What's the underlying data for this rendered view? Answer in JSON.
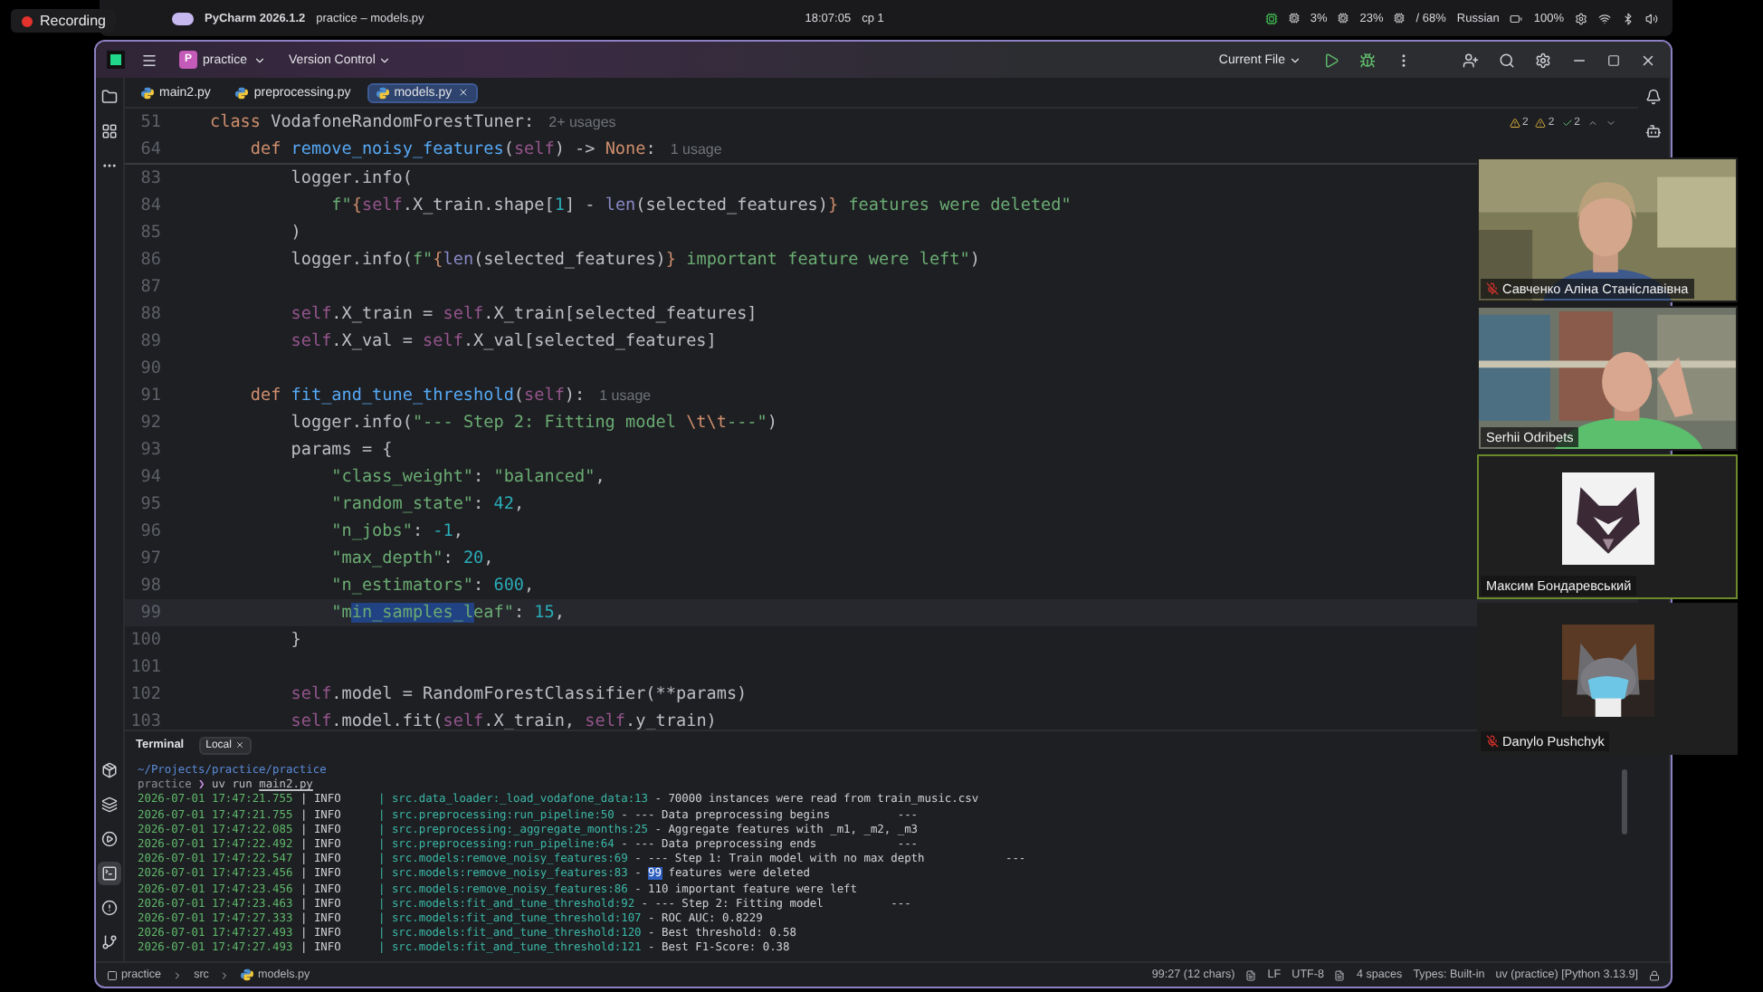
{
  "recording": {
    "label": "Recording"
  },
  "os_bar": {
    "app": "PyCharm 2026.1.2",
    "window_title": "practice – models.py",
    "clock": "18:07:05",
    "cpu": "cp 1",
    "indicators": [
      "3%",
      "23%",
      "/ 68%"
    ],
    "language": "Russian",
    "battery": "100%"
  },
  "title_bar": {
    "project": {
      "initial": "P",
      "name": "practice"
    },
    "vcs": "Version Control",
    "run_config": "Current File"
  },
  "tabs": [
    {
      "label": "main2.py",
      "selected": false
    },
    {
      "label": "preprocessing.py",
      "selected": false
    },
    {
      "label": "models.py",
      "selected": true
    }
  ],
  "inspections": [
    {
      "kind": "warning",
      "count": "2",
      "color": "#e0b43c"
    },
    {
      "kind": "weak",
      "count": "2",
      "color": "#c9a43a"
    },
    {
      "kind": "ok",
      "count": "2",
      "color": "#5fb86b"
    }
  ],
  "editor": {
    "sticky_lines": [
      {
        "number": "51",
        "tokens": [
          {
            "kind": "keyword",
            "text": "class"
          },
          {
            "kind": "plain",
            "text": " VodafoneRandomForestTuner:"
          }
        ],
        "hint": "2+ usages"
      },
      {
        "number": "64",
        "tokens": [
          {
            "kind": "keyword",
            "text": "    def "
          },
          {
            "kind": "function",
            "text": "remove_noisy_features"
          },
          {
            "kind": "plain",
            "text": "("
          },
          {
            "kind": "self",
            "text": "self"
          },
          {
            "kind": "plain",
            "text": ") -> "
          },
          {
            "kind": "keyword",
            "text": "None"
          },
          {
            "kind": "plain",
            "text": ":"
          }
        ],
        "hint": "1 usage"
      }
    ],
    "lines": [
      {
        "number": "83",
        "current": false,
        "tokens": [
          {
            "kind": "plain",
            "text": "        logger.info("
          }
        ]
      },
      {
        "number": "84",
        "current": false,
        "tokens": [
          {
            "kind": "string",
            "text": "            f\""
          },
          {
            "kind": "brace",
            "text": "{"
          },
          {
            "kind": "self",
            "text": "self"
          },
          {
            "kind": "plain",
            "text": ".X_train.shape["
          },
          {
            "kind": "number",
            "text": "1"
          },
          {
            "kind": "plain",
            "text": "] - "
          },
          {
            "kind": "builtin",
            "text": "len"
          },
          {
            "kind": "plain",
            "text": "(selected_features)"
          },
          {
            "kind": "brace",
            "text": "}"
          },
          {
            "kind": "string",
            "text": " features were deleted\""
          }
        ]
      },
      {
        "number": "85",
        "current": false,
        "tokens": [
          {
            "kind": "plain",
            "text": "        )"
          }
        ]
      },
      {
        "number": "86",
        "current": false,
        "tokens": [
          {
            "kind": "plain",
            "text": "        logger.info("
          },
          {
            "kind": "string",
            "text": "f\""
          },
          {
            "kind": "brace",
            "text": "{"
          },
          {
            "kind": "builtin",
            "text": "len"
          },
          {
            "kind": "plain",
            "text": "(selected_features)"
          },
          {
            "kind": "brace",
            "text": "}"
          },
          {
            "kind": "string",
            "text": " important feature were left\""
          },
          {
            "kind": "plain",
            "text": ")"
          }
        ]
      },
      {
        "number": "87",
        "current": false
      },
      {
        "number": "88",
        "current": false,
        "tokens": [
          {
            "kind": "self",
            "text": "        self"
          },
          {
            "kind": "plain",
            "text": ".X_train = "
          },
          {
            "kind": "self",
            "text": "self"
          },
          {
            "kind": "plain",
            "text": ".X_train[selected_features]"
          }
        ]
      },
      {
        "number": "89",
        "current": false,
        "tokens": [
          {
            "kind": "self",
            "text": "        self"
          },
          {
            "kind": "plain",
            "text": ".X_val = "
          },
          {
            "kind": "self",
            "text": "self"
          },
          {
            "kind": "plain",
            "text": ".X_val[selected_features]"
          }
        ]
      },
      {
        "number": "90",
        "current": false
      },
      {
        "number": "91",
        "current": false,
        "tokens": [
          {
            "kind": "keyword",
            "text": "    def "
          },
          {
            "kind": "function",
            "text": "fit_and_tune_threshold"
          },
          {
            "kind": "plain",
            "text": "("
          },
          {
            "kind": "self",
            "text": "self"
          },
          {
            "kind": "plain",
            "text": "):"
          }
        ],
        "hint": "1 usage"
      },
      {
        "number": "92",
        "current": false,
        "tokens": [
          {
            "kind": "plain",
            "text": "        logger.info("
          },
          {
            "kind": "string",
            "text": "\"--- Step 2: Fitting model "
          },
          {
            "kind": "escape",
            "text": "\\t\\t"
          },
          {
            "kind": "string",
            "text": "---\""
          },
          {
            "kind": "plain",
            "text": ")"
          }
        ]
      },
      {
        "number": "93",
        "current": false,
        "tokens": [
          {
            "kind": "plain",
            "text": "        params = {"
          }
        ]
      },
      {
        "number": "94",
        "current": false,
        "tokens": [
          {
            "kind": "string",
            "text": "            \"class_weight\""
          },
          {
            "kind": "plain",
            "text": ": "
          },
          {
            "kind": "string",
            "text": "\"balanced\""
          },
          {
            "kind": "plain",
            "text": ","
          }
        ]
      },
      {
        "number": "95",
        "current": false,
        "tokens": [
          {
            "kind": "string",
            "text": "            \"random_state\""
          },
          {
            "kind": "plain",
            "text": ": "
          },
          {
            "kind": "number",
            "text": "42"
          },
          {
            "kind": "plain",
            "text": ","
          }
        ]
      },
      {
        "number": "96",
        "current": false,
        "tokens": [
          {
            "kind": "string",
            "text": "            \"n_jobs\""
          },
          {
            "kind": "plain",
            "text": ": "
          },
          {
            "kind": "number",
            "text": "-1"
          },
          {
            "kind": "plain",
            "text": ","
          }
        ]
      },
      {
        "number": "97",
        "current": false,
        "tokens": [
          {
            "kind": "string",
            "text": "            \"max_depth\""
          },
          {
            "kind": "plain",
            "text": ": "
          },
          {
            "kind": "number",
            "text": "20"
          },
          {
            "kind": "plain",
            "text": ","
          }
        ]
      },
      {
        "number": "98",
        "current": false,
        "tokens": [
          {
            "kind": "string",
            "text": "            \"n_estimators\""
          },
          {
            "kind": "plain",
            "text": ": "
          },
          {
            "kind": "number",
            "text": "600"
          },
          {
            "kind": "plain",
            "text": ","
          }
        ]
      },
      {
        "number": "99",
        "current": true,
        "tokens": [
          {
            "kind": "string",
            "text": "            \"m"
          },
          {
            "kind": "selection",
            "text": "in_samples_l"
          },
          {
            "kind": "string",
            "text": "eaf\""
          },
          {
            "kind": "plain",
            "text": ": "
          },
          {
            "kind": "number",
            "text": "15"
          },
          {
            "kind": "plain",
            "text": ","
          }
        ]
      },
      {
        "number": "100",
        "current": false,
        "tokens": [
          {
            "kind": "plain",
            "text": "        }"
          }
        ]
      },
      {
        "number": "101",
        "current": false
      },
      {
        "number": "102",
        "current": false,
        "tokens": [
          {
            "kind": "self",
            "text": "        self"
          },
          {
            "kind": "plain",
            "text": ".model = RandomForestClassifier(**params)"
          }
        ]
      },
      {
        "number": "103",
        "current": false,
        "tokens": [
          {
            "kind": "self",
            "text": "        self"
          },
          {
            "kind": "plain",
            "text": ".model.fit("
          },
          {
            "kind": "self",
            "text": "self"
          },
          {
            "kind": "plain",
            "text": ".X_train, "
          },
          {
            "kind": "self",
            "text": "self"
          },
          {
            "kind": "plain",
            "text": ".y_train)"
          }
        ]
      }
    ]
  },
  "terminal": {
    "title": "Terminal",
    "tabs": [
      {
        "label": "Local",
        "selected": true
      }
    ],
    "path": "~/Projects/practice/practice",
    "prompt": {
      "dir": "practice",
      "symbol": "❯",
      "command": "uv run",
      "arg": "main2.py"
    },
    "logs": [
      {
        "time": "2026-07-01 17:47:21.755",
        "level": "| INFO",
        "source": "| src.data_loader:_load_vodafone_data:13",
        "message": "- 70000 instances were read from train_music.csv"
      },
      {
        "time": "2026-07-01 17:47:21.755",
        "level": "| INFO",
        "source": "| src.preprocessing:run_pipeline:50",
        "message": "- --- Data preprocessing begins          ---"
      },
      {
        "time": "2026-07-01 17:47:22.085",
        "level": "| INFO",
        "source": "| src.preprocessing:_aggregate_months:25",
        "message": "- Aggregate features with _m1, _m2, _m3"
      },
      {
        "time": "2026-07-01 17:47:22.492",
        "level": "| INFO",
        "source": "| src.preprocessing:run_pipeline:64",
        "message": "- --- Data preprocessing ends            ---"
      },
      {
        "time": "2026-07-01 17:47:22.547",
        "level": "| INFO",
        "source": "| src.models:remove_noisy_features:69",
        "message": "- --- Step 1: Train model with no max depth            ---"
      },
      {
        "time": "2026-07-01 17:47:23.456",
        "level": "| INFO",
        "source": "| src.models:remove_noisy_features:83",
        "message": "-",
        "highlight": "99",
        "rest": "features were deleted"
      },
      {
        "time": "2026-07-01 17:47:23.456",
        "level": "| INFO",
        "source": "| src.models:remove_noisy_features:86",
        "message": "- 110 important feature were left"
      },
      {
        "time": "2026-07-01 17:47:23.463",
        "level": "| INFO",
        "source": "| src.models:fit_and_tune_threshold:92",
        "message": "- --- Step 2: Fitting model          ---"
      },
      {
        "time": "2026-07-01 17:47:27.333",
        "level": "| INFO",
        "source": "| src.models:fit_and_tune_threshold:107",
        "message": "- ROC AUC: 0.8229"
      },
      {
        "time": "2026-07-01 17:47:27.493",
        "level": "| INFO",
        "source": "| src.models:fit_and_tune_threshold:120",
        "message": "- Best threshold: 0.58"
      },
      {
        "time": "2026-07-01 17:47:27.493",
        "level": "| INFO",
        "source": "| src.models:fit_and_tune_threshold:121",
        "message": "- Best F1-Score: 0.38"
      }
    ]
  },
  "status_bar": {
    "breadcrumbs": [
      "practice",
      "src",
      "models.py"
    ],
    "position": "99:27 (12 chars)",
    "line_ending": "LF",
    "encoding": "UTF-8",
    "indent": "4 spaces",
    "types": "Types: Built-in",
    "interpreter": "uv (practice) [Python 3.13.9]"
  },
  "participants": [
    {
      "name": "Савченко Аліна Станіславівна",
      "kind": "video",
      "muted": true,
      "speaking": false
    },
    {
      "name": "Serhii Odribets",
      "kind": "video",
      "muted": false,
      "speaking": false
    },
    {
      "name": "Максим Бондаревський",
      "kind": "avatar",
      "muted": false,
      "speaking": true
    },
    {
      "name": "Danylo Pushchyk",
      "kind": "avatar",
      "muted": true,
      "speaking": false
    }
  ]
}
